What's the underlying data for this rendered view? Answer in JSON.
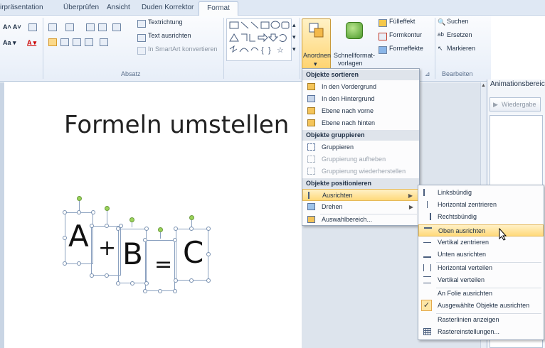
{
  "tabs": [
    "irpräsentation",
    "Überprüfen",
    "Ansicht",
    "Duden Korrektor",
    "Format"
  ],
  "ribbon": {
    "absatz_label": "Absatz",
    "text_direction": "Textrichtung",
    "text_align": "Text ausrichten",
    "smartart": "In SmartArt konvertieren",
    "arrange": "Anordnen",
    "quick_styles_1": "Schnellformat-",
    "quick_styles_2": "vorlagen",
    "fill": "Fülleffekt",
    "outline": "Formkontur",
    "effects": "Formeffekte",
    "find": "Suchen",
    "replace": "Ersetzen",
    "select": "Markieren",
    "edit_label": "Bearbeiten"
  },
  "anim": {
    "title": "Animationsbereich",
    "play": "Wiedergabe"
  },
  "slide": {
    "title": "Formeln umstellen",
    "a": "A",
    "plus": "+",
    "b": "B",
    "eq": "=",
    "c": "C"
  },
  "menu1": {
    "h1": "Objekte sortieren",
    "i1": "In den Vordergrund",
    "i2": "In den Hintergrund",
    "i3": "Ebene nach vorne",
    "i4": "Ebene nach hinten",
    "h2": "Objekte gruppieren",
    "i5": "Gruppieren",
    "i6": "Gruppierung aufheben",
    "i7": "Gruppierung wiederherstellen",
    "h3": "Objekte positionieren",
    "i8": "Ausrichten",
    "i9": "Drehen",
    "i10": "Auswahlbereich..."
  },
  "menu2": {
    "i1": "Linksbündig",
    "i2": "Horizontal zentrieren",
    "i3": "Rechtsbündig",
    "i4": "Oben ausrichten",
    "i5": "Vertikal zentrieren",
    "i6": "Unten ausrichten",
    "i7": "Horizontal verteilen",
    "i8": "Vertikal verteilen",
    "i9": "An Folie ausrichten",
    "i10": "Ausgewählte Objekte ausrichten",
    "i11": "Rasterlinien anzeigen",
    "i12": "Rastereinstellungen..."
  }
}
